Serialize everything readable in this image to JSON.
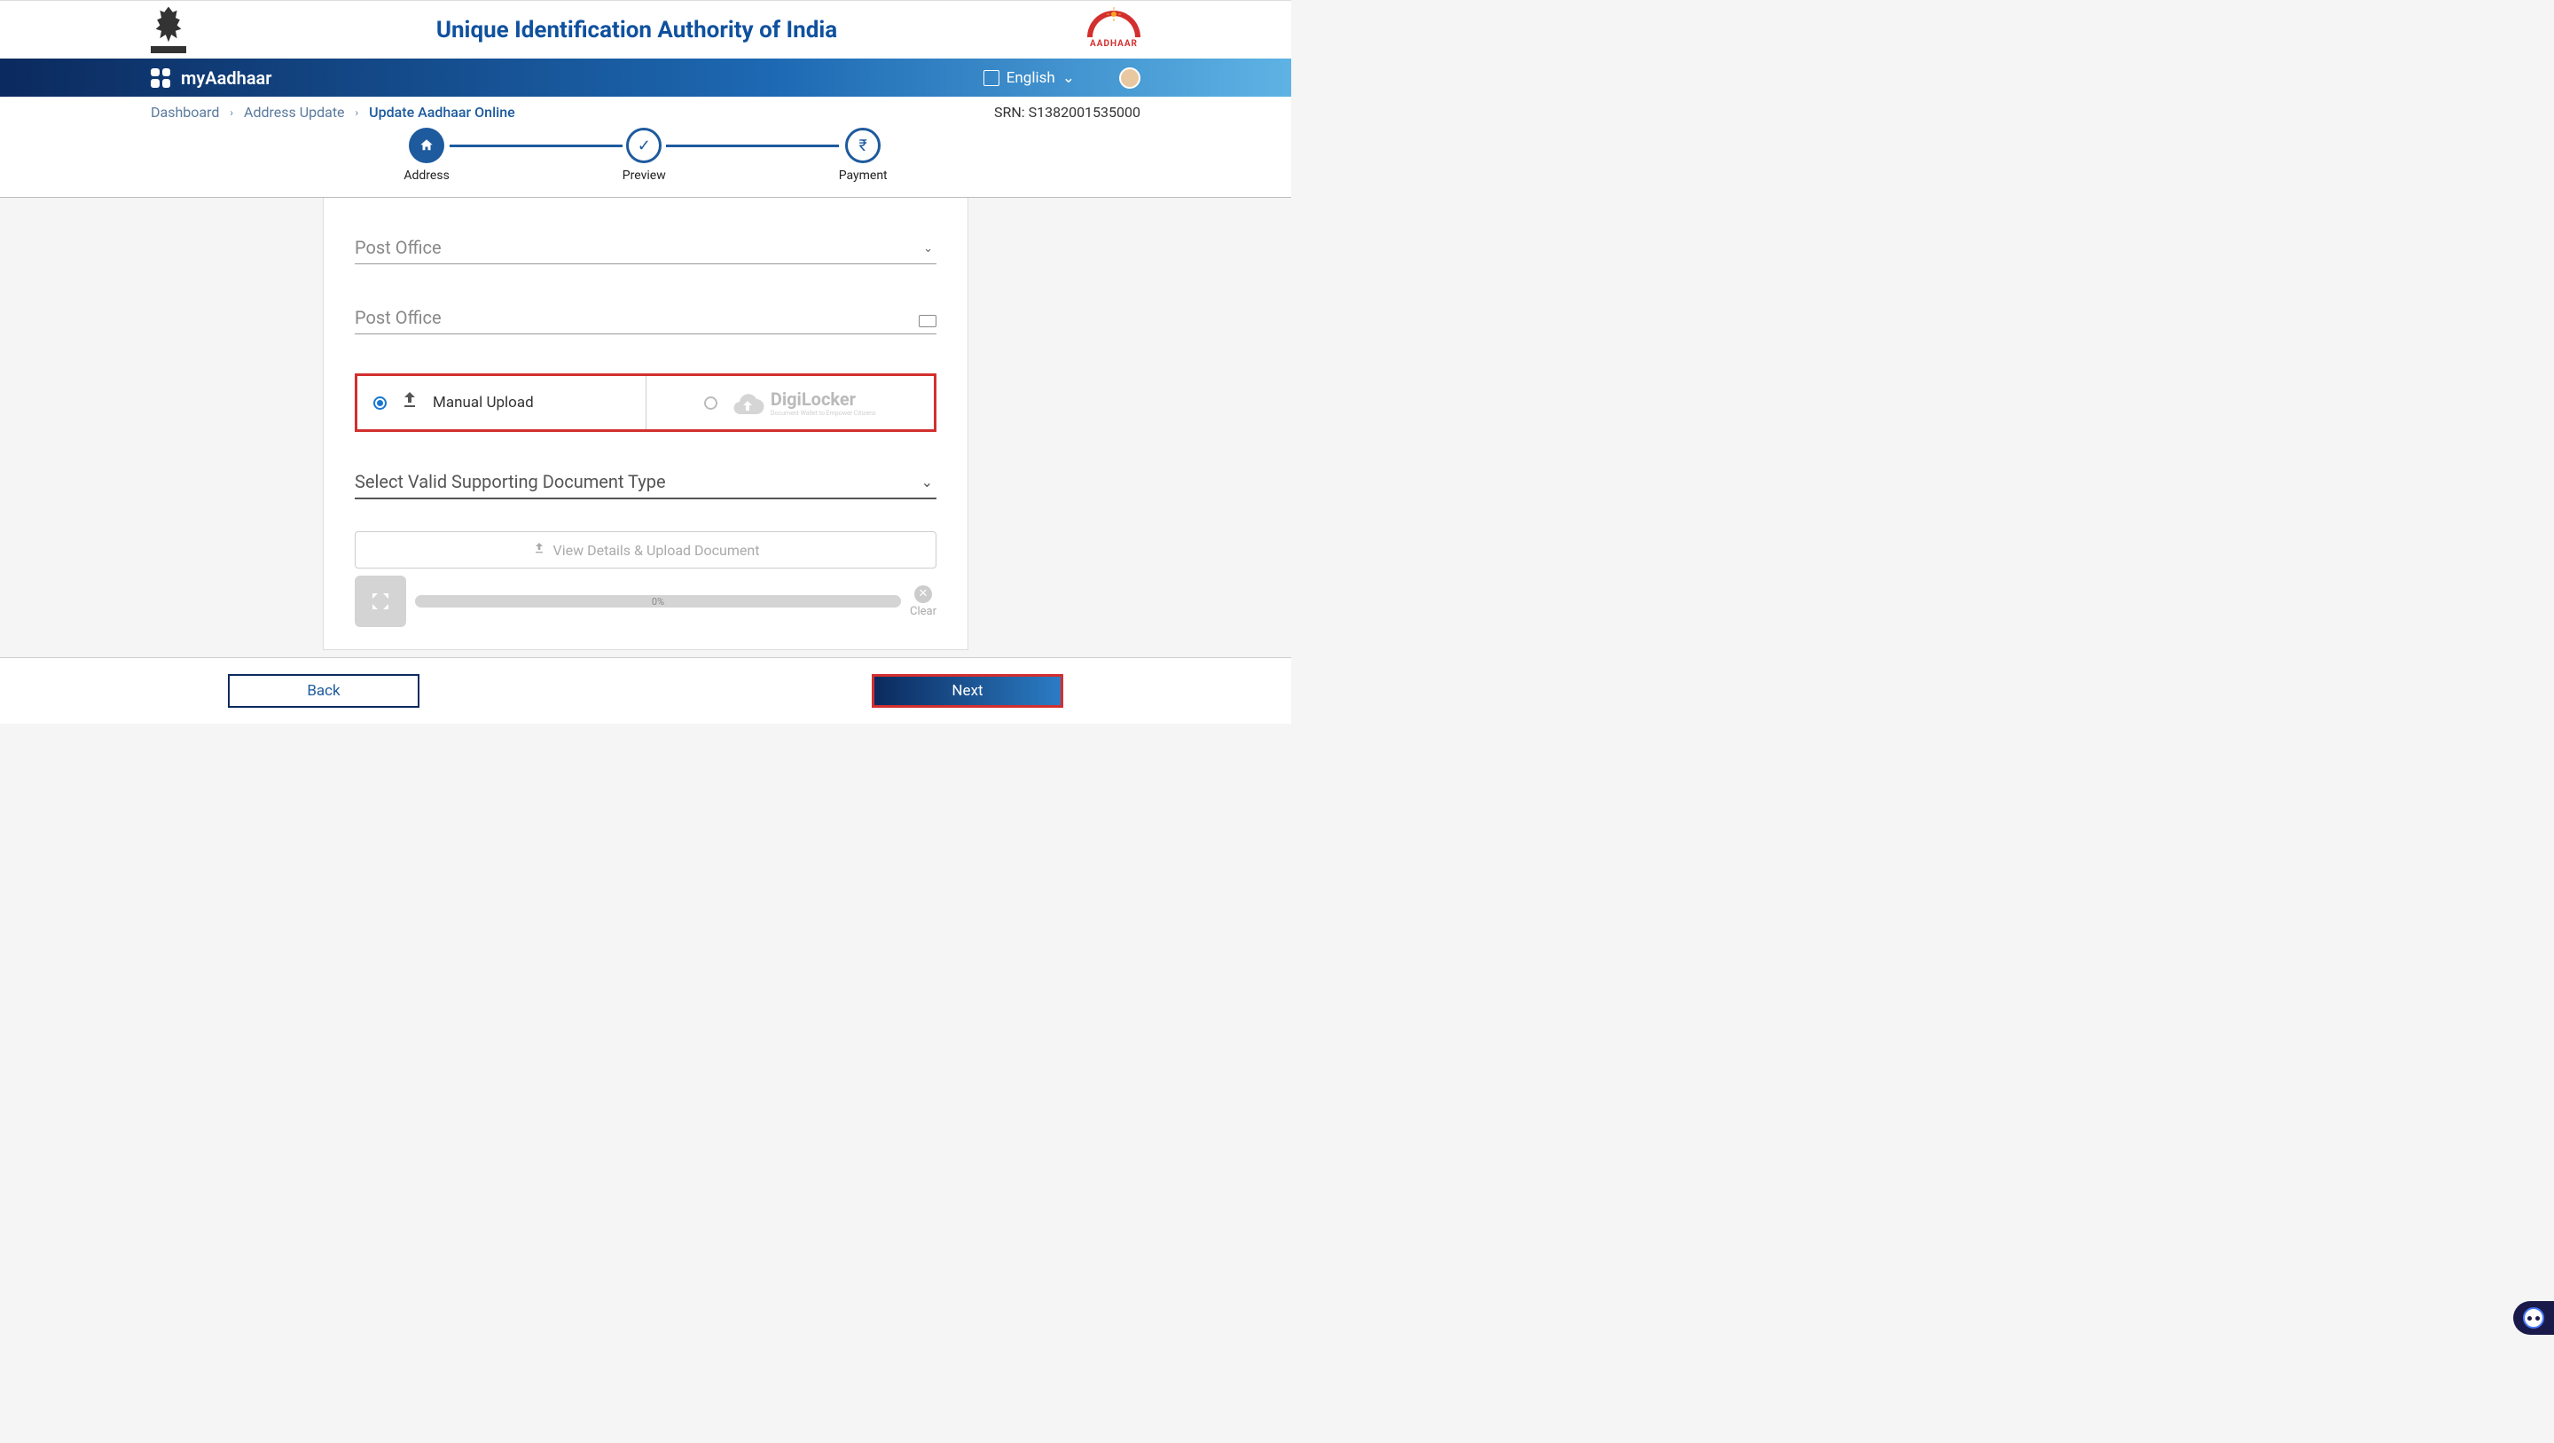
{
  "header": {
    "title": "Unique Identification Authority of India",
    "aadhaar_label": "AADHAAR"
  },
  "navbar": {
    "brand": "myAadhaar",
    "language": "English"
  },
  "breadcrumb": {
    "items": [
      "Dashboard",
      "Address Update",
      "Update Aadhaar Online"
    ],
    "srn_label": "SRN: S1382001535000"
  },
  "stepper": {
    "steps": [
      {
        "label": "Address",
        "icon": "home"
      },
      {
        "label": "Preview",
        "icon": "check"
      },
      {
        "label": "Payment",
        "icon": "rupee"
      }
    ]
  },
  "form": {
    "post_office_1": "Post Office",
    "post_office_2": "Post Office",
    "upload": {
      "manual_label": "Manual Upload",
      "digilocker_label": "DigiLocker",
      "digilocker_sub": "Document Wallet to Empower Citizens"
    },
    "doc_type_label": "Select Valid Supporting Document Type",
    "upload_button": "View Details & Upload Document",
    "progress_pct": "0%",
    "clear_label": "Clear"
  },
  "footer": {
    "back": "Back",
    "next": "Next"
  }
}
